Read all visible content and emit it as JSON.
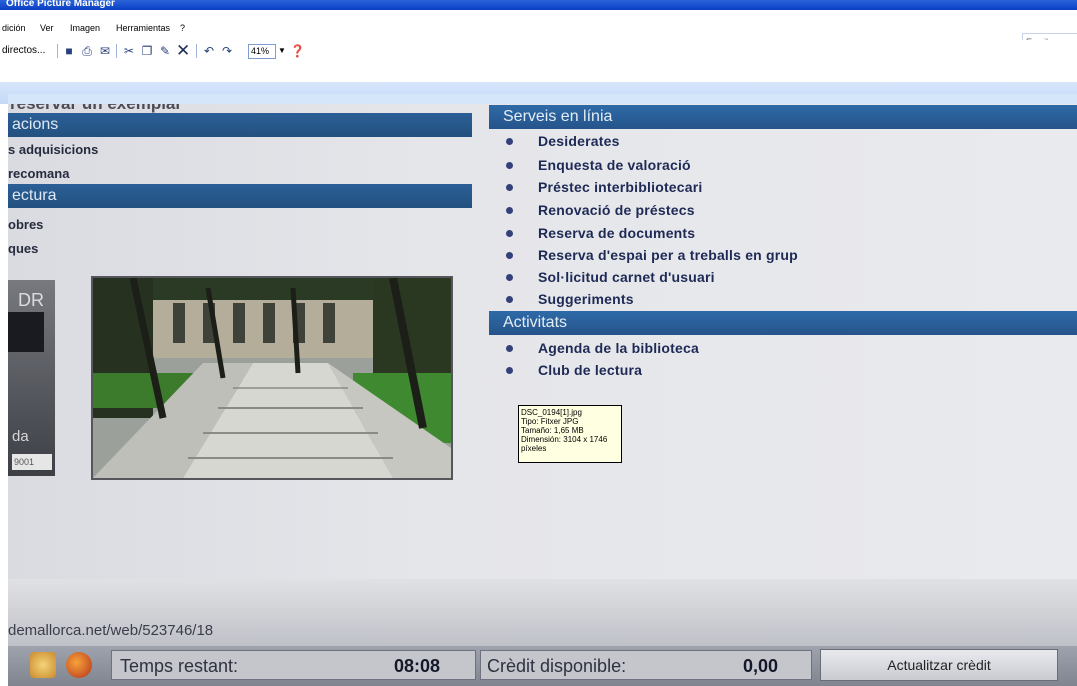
{
  "window": {
    "title": "Office Picture Manager"
  },
  "menu": {
    "items": [
      "dición",
      "Ver",
      "Imagen",
      "Herramientas",
      "?"
    ],
    "help_placeholder": "Escriba una p"
  },
  "toolbar": {
    "shortcuts_label": "directos...",
    "zoom": "41%",
    "icons": [
      "save-icon",
      "print-icon",
      "email-icon",
      "cut-icon",
      "copy-icon",
      "paste-icon",
      "delete-icon",
      "undo-icon",
      "redo-icon",
      "help-icon"
    ]
  },
  "page": {
    "cut_heading": "reservar un exemplar",
    "left_sections": [
      {
        "title": "acions",
        "items": [
          "s adquisicions",
          "recomana"
        ]
      },
      {
        "title": "ectura",
        "items": [
          "obres",
          "ques"
        ]
      }
    ],
    "logo": {
      "letters": "DR",
      "text": "da",
      "number": "9001"
    },
    "right_sections": [
      {
        "title": "Serveis en línia",
        "items": [
          "Desiderates",
          "Enquesta de valoració",
          "Préstec interbibliotecari",
          "Renovació de préstecs",
          "Reserva de documents",
          "Reserva d'espai per a treballs en grup",
          "Sol·licitud carnet d'usuari",
          "Suggeriments"
        ]
      },
      {
        "title": "Activitats",
        "items": [
          "Agenda de la biblioteca",
          "Club de lectura"
        ]
      }
    ]
  },
  "tooltip": {
    "filename": "DSC_0194[1].jpg",
    "type": "Tipo: Fitxer JPG",
    "size": "Tamaño: 1,65 MB",
    "dimension": "Dimensión: 3104 x 1746",
    "unit": "píxeles"
  },
  "kiosk": {
    "url": "demallorca.net/web/523746/18",
    "time_label": "Temps restant:",
    "time_value": "08:08",
    "credit_label": "Crèdit disponible:",
    "credit_value": "0,00",
    "update_button": "Actualitzar crèdit"
  }
}
